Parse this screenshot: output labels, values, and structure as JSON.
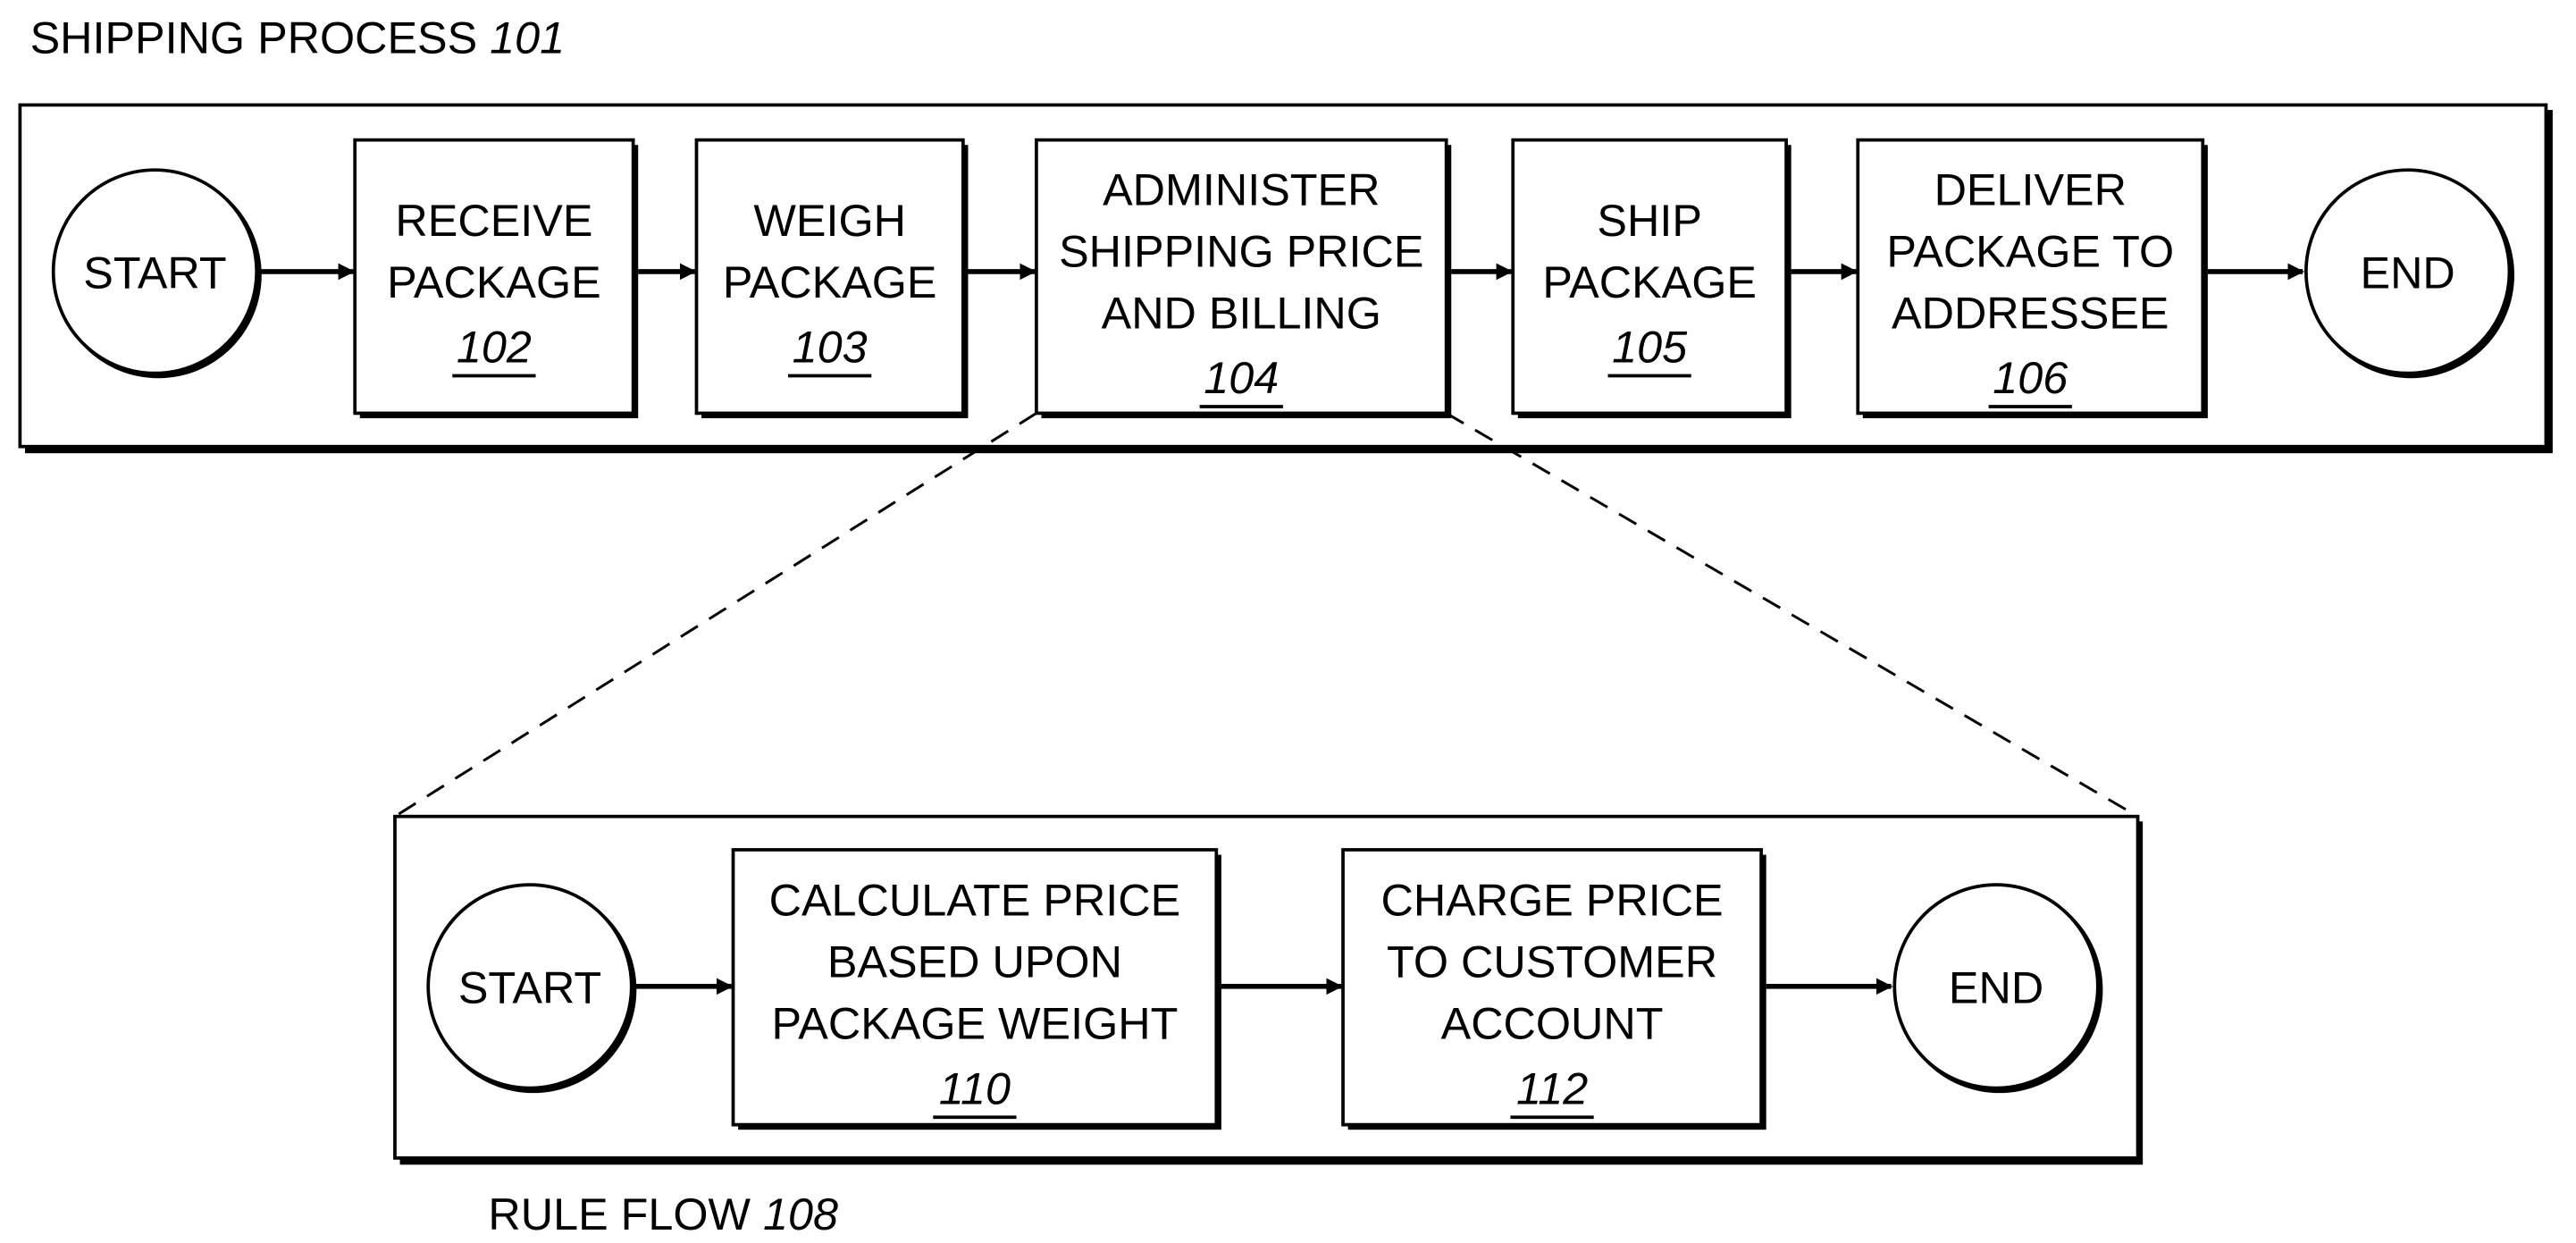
{
  "shipping_process": {
    "title": "SHIPPING PROCESS",
    "ref": "101",
    "start_label": "START",
    "end_label": "END",
    "steps": [
      {
        "lines": [
          "RECEIVE",
          "PACKAGE"
        ],
        "ref": "102"
      },
      {
        "lines": [
          "WEIGH",
          "PACKAGE"
        ],
        "ref": "103"
      },
      {
        "lines": [
          "ADMINISTER",
          "SHIPPING PRICE",
          "AND BILLING"
        ],
        "ref": "104"
      },
      {
        "lines": [
          "SHIP",
          "PACKAGE"
        ],
        "ref": "105"
      },
      {
        "lines": [
          "DELIVER",
          "PACKAGE TO",
          "ADDRESSEE"
        ],
        "ref": "106"
      }
    ]
  },
  "rule_flow": {
    "title": "RULE FLOW",
    "ref": "108",
    "start_label": "START",
    "end_label": "END",
    "steps": [
      {
        "lines": [
          "CALCULATE PRICE",
          "BASED UPON",
          "PACKAGE WEIGHT"
        ],
        "ref": "110"
      },
      {
        "lines": [
          "CHARGE PRICE",
          "TO CUSTOMER",
          "ACCOUNT"
        ],
        "ref": "112"
      }
    ],
    "expands_step_ref": "104"
  }
}
